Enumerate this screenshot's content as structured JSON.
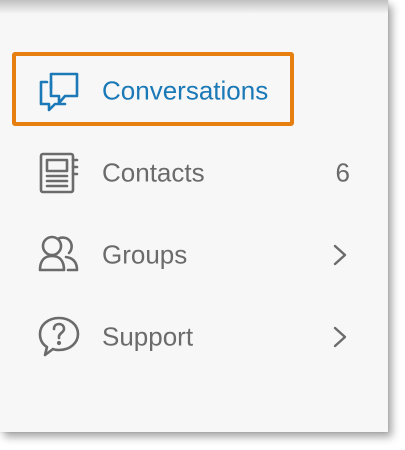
{
  "nav": {
    "items": [
      {
        "label": "Conversations",
        "icon": "chat-icon",
        "active": true
      },
      {
        "label": "Contacts",
        "icon": "contacts-book-icon",
        "count": "6"
      },
      {
        "label": "Groups",
        "icon": "group-icon",
        "chevron": "chevron-right-icon"
      },
      {
        "label": "Support",
        "icon": "help-bubble-icon",
        "chevron": "chevron-right-icon"
      }
    ]
  },
  "colors": {
    "active_text": "#1a79b6",
    "inactive_text": "#6b6b6b",
    "highlight_border": "#e67e10",
    "panel_background": "#f7f7f7"
  }
}
